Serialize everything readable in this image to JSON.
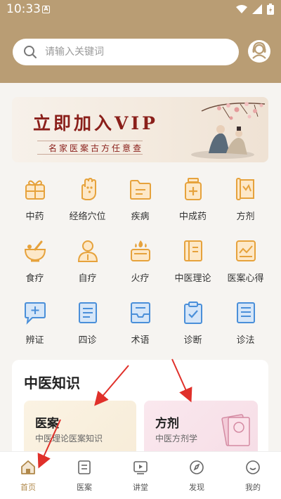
{
  "status_bar": {
    "time": "10:33",
    "notification_glyph": "A"
  },
  "search": {
    "placeholder": "请输入关键词"
  },
  "banner": {
    "title": "立即加入VIP",
    "subtitle": "名家医案古方任意查"
  },
  "categories": [
    {
      "label": "中药",
      "icon": "herb-box-icon"
    },
    {
      "label": "经络穴位",
      "icon": "hand-acupoint-icon"
    },
    {
      "label": "疾病",
      "icon": "folder-icon"
    },
    {
      "label": "中成药",
      "icon": "medicine-bottle-icon"
    },
    {
      "label": "方剂",
      "icon": "scroll-icon"
    },
    {
      "label": "食疗",
      "icon": "mortar-bowl-icon"
    },
    {
      "label": "自疗",
      "icon": "person-icon"
    },
    {
      "label": "火疗",
      "icon": "fire-therapy-icon"
    },
    {
      "label": "中医理论",
      "icon": "book-icon"
    },
    {
      "label": "医案心得",
      "icon": "chart-note-icon"
    },
    {
      "label": "辨证",
      "icon": "chat-add-icon"
    },
    {
      "label": "四诊",
      "icon": "document-icon"
    },
    {
      "label": "术语",
      "icon": "inbox-icon"
    },
    {
      "label": "诊断",
      "icon": "clipboard-check-icon"
    },
    {
      "label": "诊法",
      "icon": "list-doc-icon"
    }
  ],
  "knowledge": {
    "title": "中医知识",
    "cards": [
      {
        "title": "医案",
        "subtitle": "中医理论医案知识"
      },
      {
        "title": "方剂",
        "subtitle": "中医方剂学"
      }
    ]
  },
  "tabs": [
    {
      "label": "首页",
      "icon": "home-icon",
      "active": true
    },
    {
      "label": "医案",
      "icon": "note-icon",
      "active": false
    },
    {
      "label": "讲堂",
      "icon": "video-icon",
      "active": false
    },
    {
      "label": "发现",
      "icon": "compass-icon",
      "active": false
    },
    {
      "label": "我的",
      "icon": "smile-icon",
      "active": false
    }
  ],
  "colors": {
    "accent": "#b0884a",
    "header": "#b99d74",
    "icon": "#e6a23c",
    "icon_blue": "#4a8fd9",
    "annotation": "#e0302a",
    "banner_text": "#8a1f1a"
  }
}
